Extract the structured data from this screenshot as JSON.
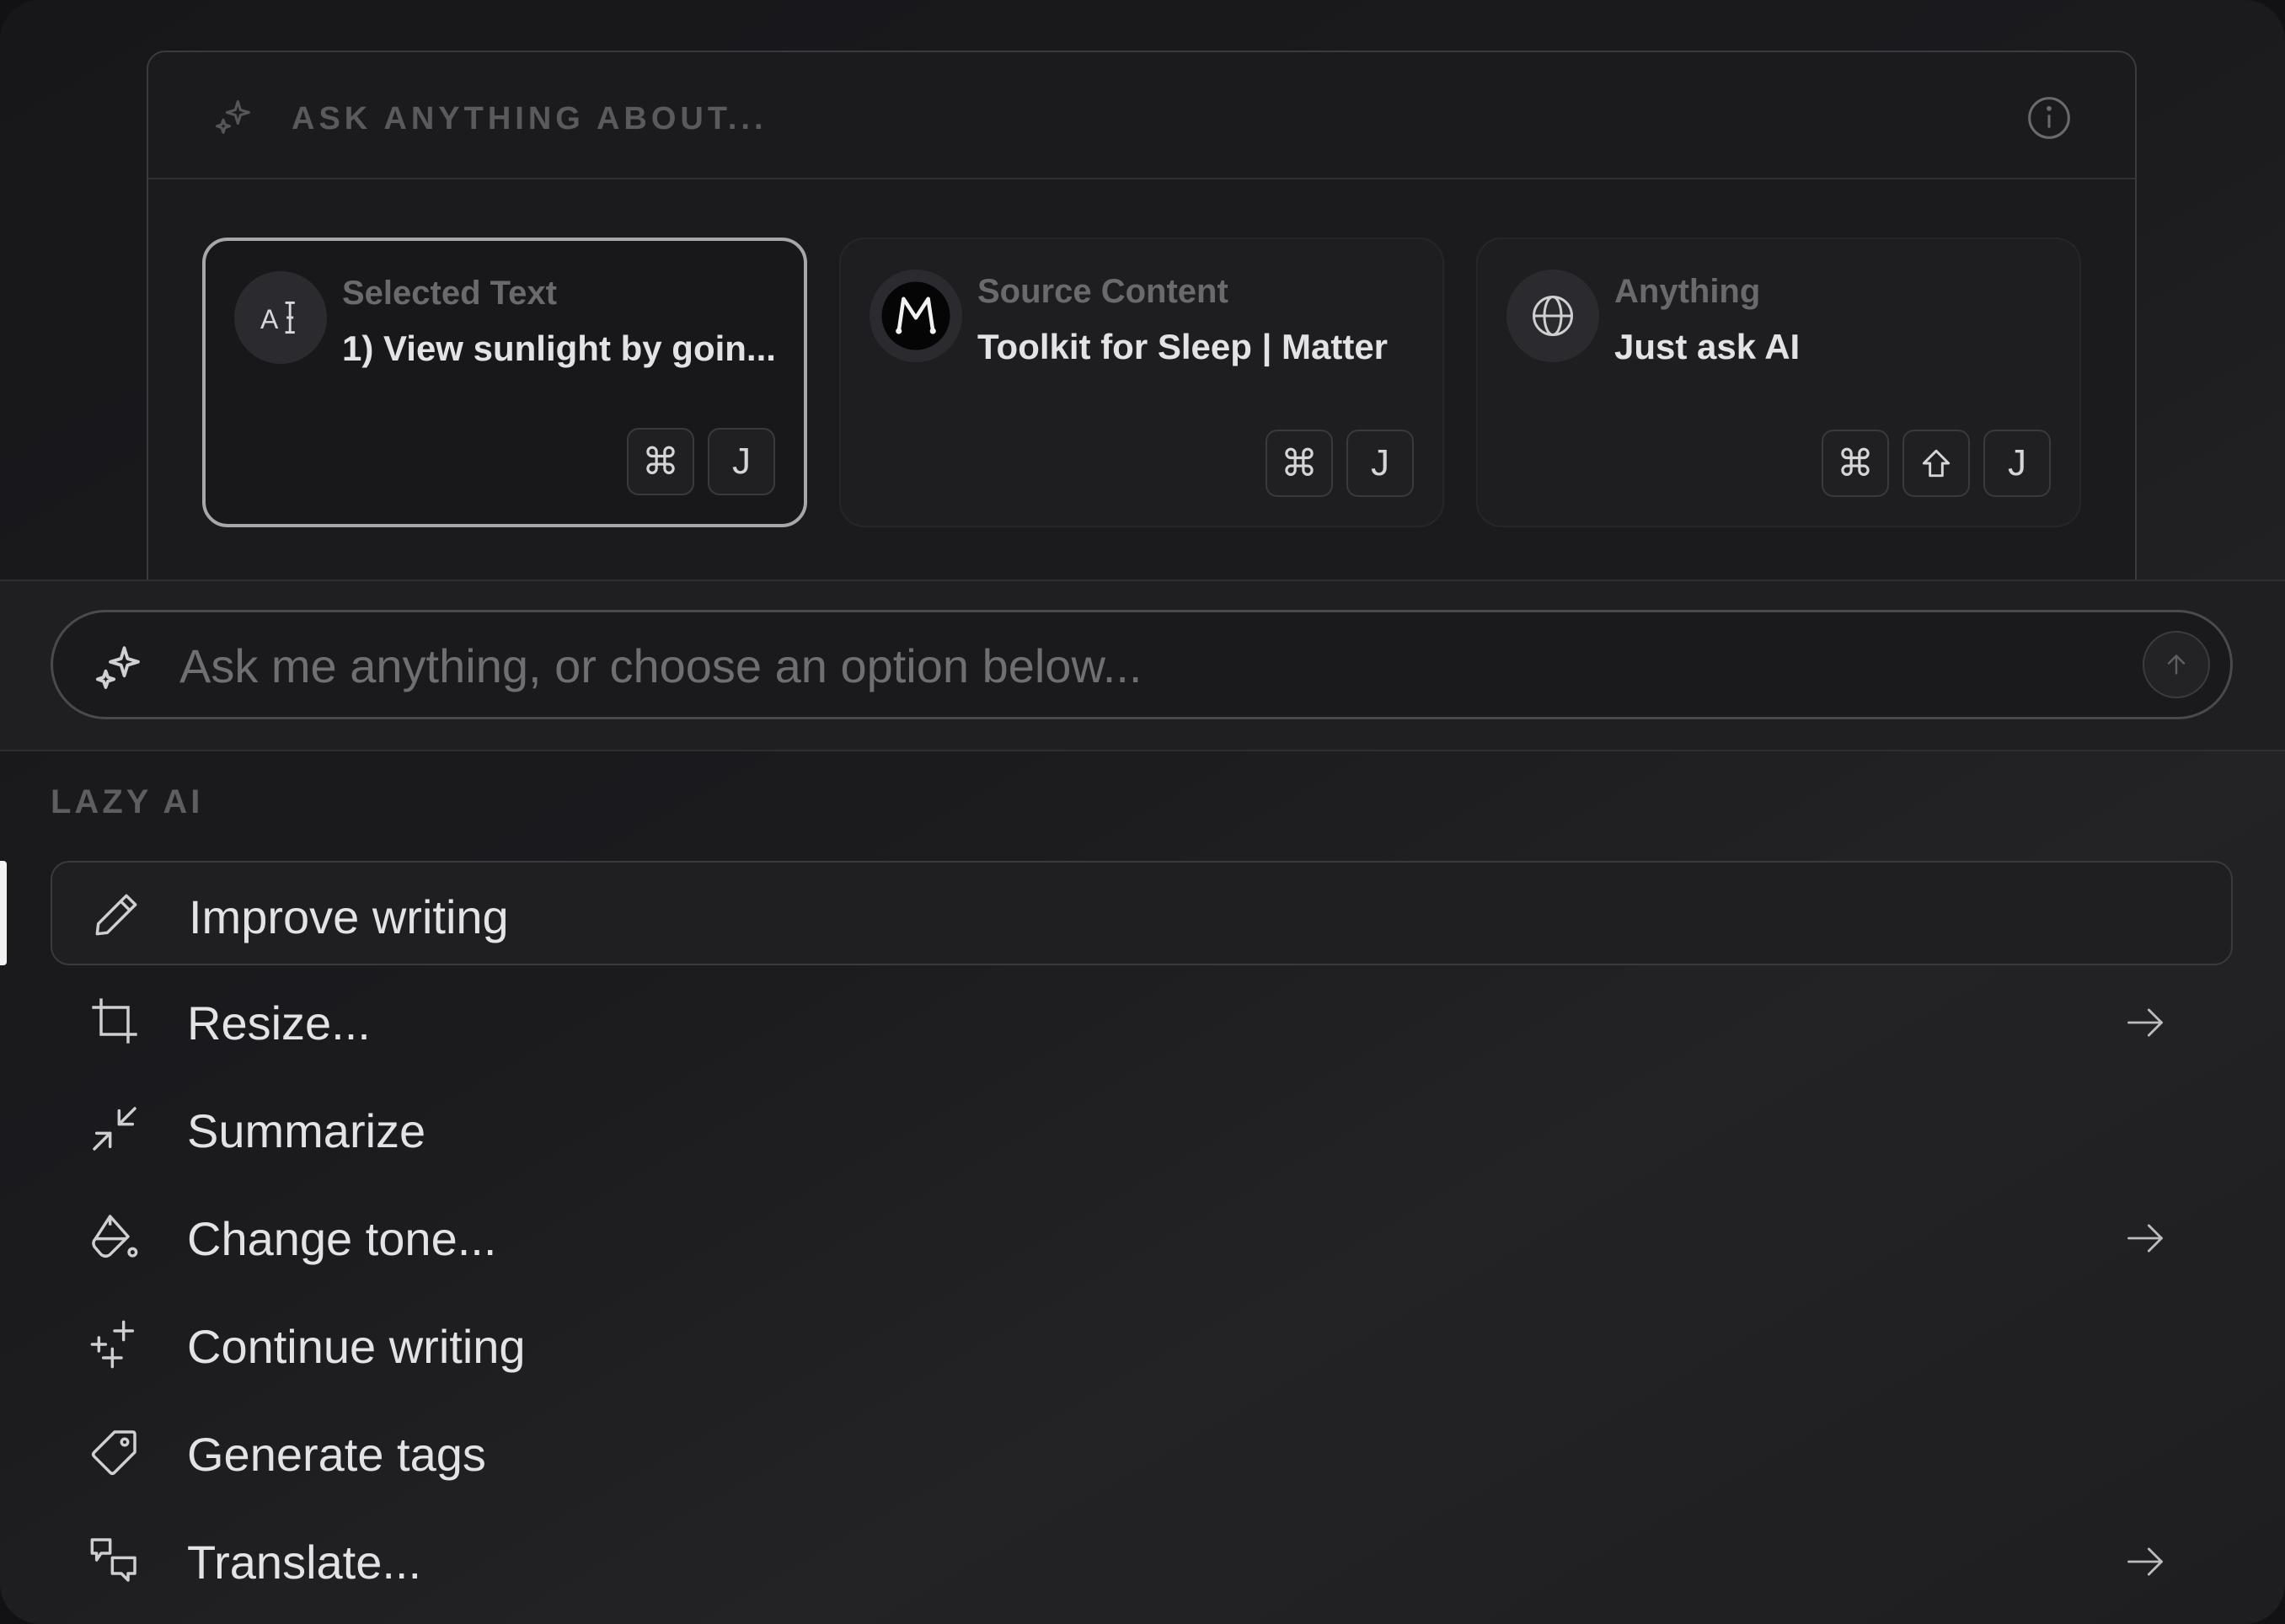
{
  "context": {
    "title": "ASK ANYTHING ABOUT...",
    "sources": [
      {
        "label": "Selected Text",
        "value": "1) View sunlight by goin...",
        "icon": "text-cursor-icon",
        "keys": [
          "⌘",
          "J"
        ],
        "selected": true
      },
      {
        "label": "Source Content",
        "value": "Toolkit for Sleep | Matter",
        "icon": "matter-logo-icon",
        "keys": [
          "⌘",
          "J"
        ],
        "selected": false
      },
      {
        "label": "Anything",
        "value": "Just ask AI",
        "icon": "globe-icon",
        "keys": [
          "⌘",
          "shift-icon",
          "J"
        ],
        "selected": false
      }
    ]
  },
  "search": {
    "placeholder": "Ask me anything, or choose an option below...",
    "value": ""
  },
  "menu": {
    "section_label": "LAZY AI",
    "items": [
      {
        "label": "Improve writing",
        "icon": "pencil-icon",
        "submenu": false,
        "selected": true
      },
      {
        "label": "Resize...",
        "icon": "crop-icon",
        "submenu": true
      },
      {
        "label": "Summarize",
        "icon": "minimize-arrows-icon",
        "submenu": false
      },
      {
        "label": "Change tone...",
        "icon": "paint-bucket-icon",
        "submenu": true
      },
      {
        "label": "Continue writing",
        "icon": "sparkles-plus-icon",
        "submenu": false
      },
      {
        "label": "Generate tags",
        "icon": "tag-icon",
        "submenu": false
      },
      {
        "label": "Translate...",
        "icon": "speech-bubbles-icon",
        "submenu": true
      }
    ]
  },
  "colors": {
    "background": "#1b1b1e",
    "text": "#e3e3e5",
    "muted": "#6a6a6e",
    "selected_border": "#a7a7ab"
  }
}
